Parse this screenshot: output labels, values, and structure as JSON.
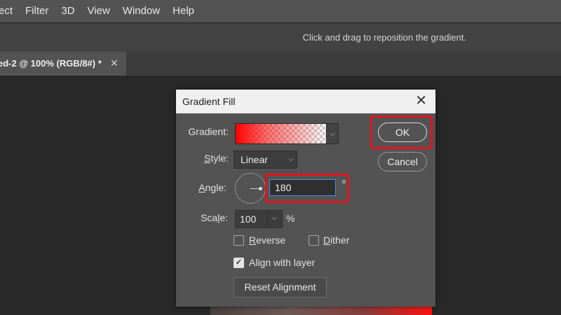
{
  "menubar": {
    "items": [
      "ect",
      "Filter",
      "3D",
      "View",
      "Window",
      "Help"
    ]
  },
  "options_bar": {
    "hint": "Click and drag to reposition the gradient."
  },
  "document_tab": {
    "label": "ed-2 @ 100% (RGB/8#) *",
    "close": "✕"
  },
  "dialog": {
    "title": "Gradient Fill",
    "close": "✕",
    "gradient_label": "Gradient:",
    "gradient_colors": [
      "#ff0000",
      "transparent"
    ],
    "style_label_pre": "",
    "style_label_mnemonic": "S",
    "style_label_post": "tyle:",
    "style_value": "Linear",
    "angle_label_pre": "",
    "angle_label_mnemonic": "A",
    "angle_label_post": "ngle:",
    "angle_value": "180",
    "degree_symbol": "º",
    "scale_label_pre": "Sca",
    "scale_label_mnemonic": "l",
    "scale_label_post": "e:",
    "scale_value": "100",
    "percent": "%",
    "reverse_label_mnemonic": "R",
    "reverse_label_rest": "everse",
    "reverse_checked": false,
    "dither_label_mnemonic": "D",
    "dither_label_rest": "ither",
    "dither_checked": false,
    "align_label": "Align with layer",
    "align_checked": true,
    "reset_button": "Reset Alignment",
    "ok_button": "OK",
    "cancel_button": "Cancel",
    "chevron": "⌵",
    "checkmark": "✓"
  },
  "highlight_color": "#e3121e"
}
